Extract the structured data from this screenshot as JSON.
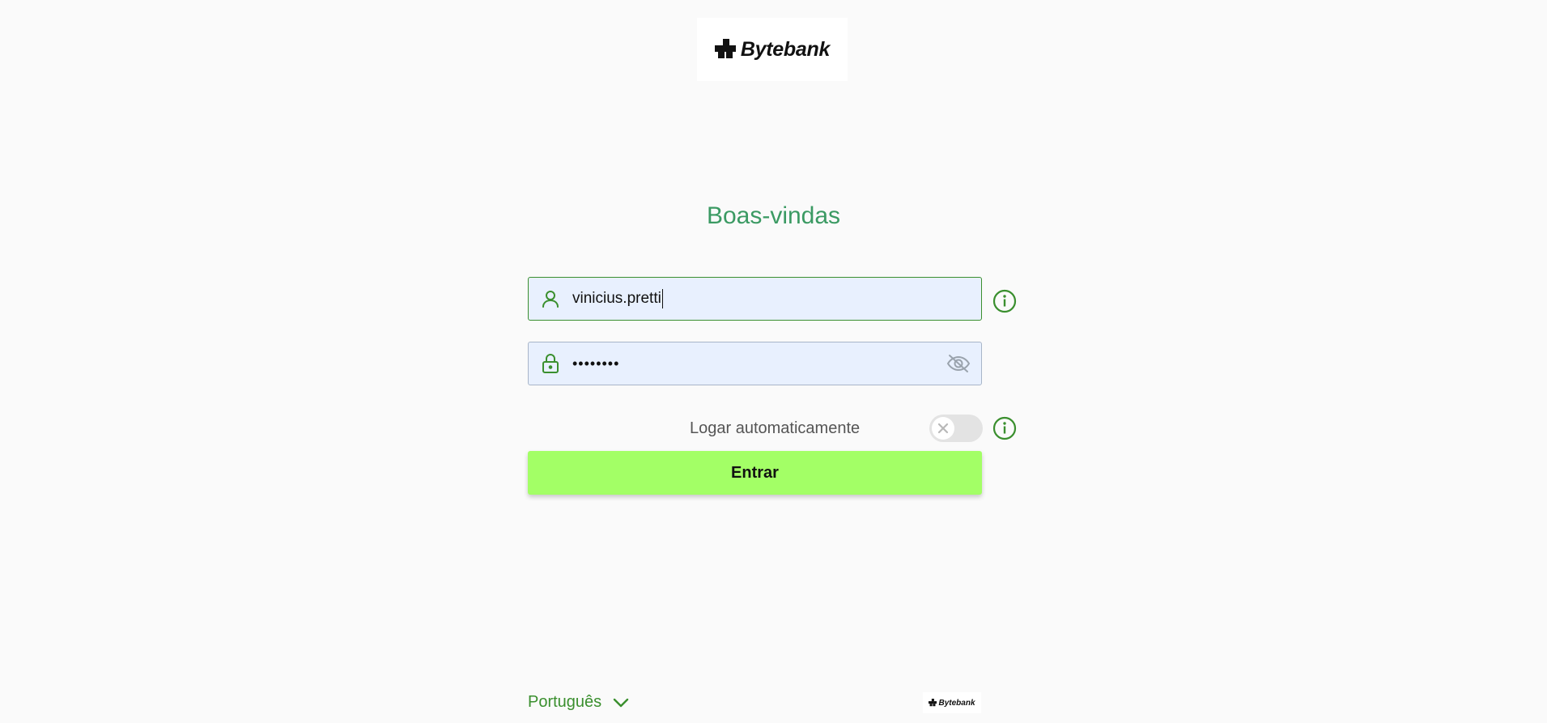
{
  "brand": {
    "name": "Bytebank"
  },
  "login": {
    "title": "Boas-vindas",
    "username": {
      "value": "vinicius.pretti",
      "icon": "user-icon"
    },
    "password": {
      "value": "••••••••",
      "icon": "lock-icon",
      "toggle_icon": "eye-off-icon"
    },
    "auto_login": {
      "label": "Logar automaticamente",
      "enabled": false
    },
    "submit_label": "Entrar"
  },
  "footer": {
    "language": "Português",
    "language_icon": "chevron-down-icon",
    "small_logo": "Bytebank"
  },
  "colors": {
    "accent": "#3a8f2e",
    "title": "#3b9a63",
    "button": "#a3ff66",
    "field_bg": "#e8f0fe",
    "background": "#fafafa"
  }
}
